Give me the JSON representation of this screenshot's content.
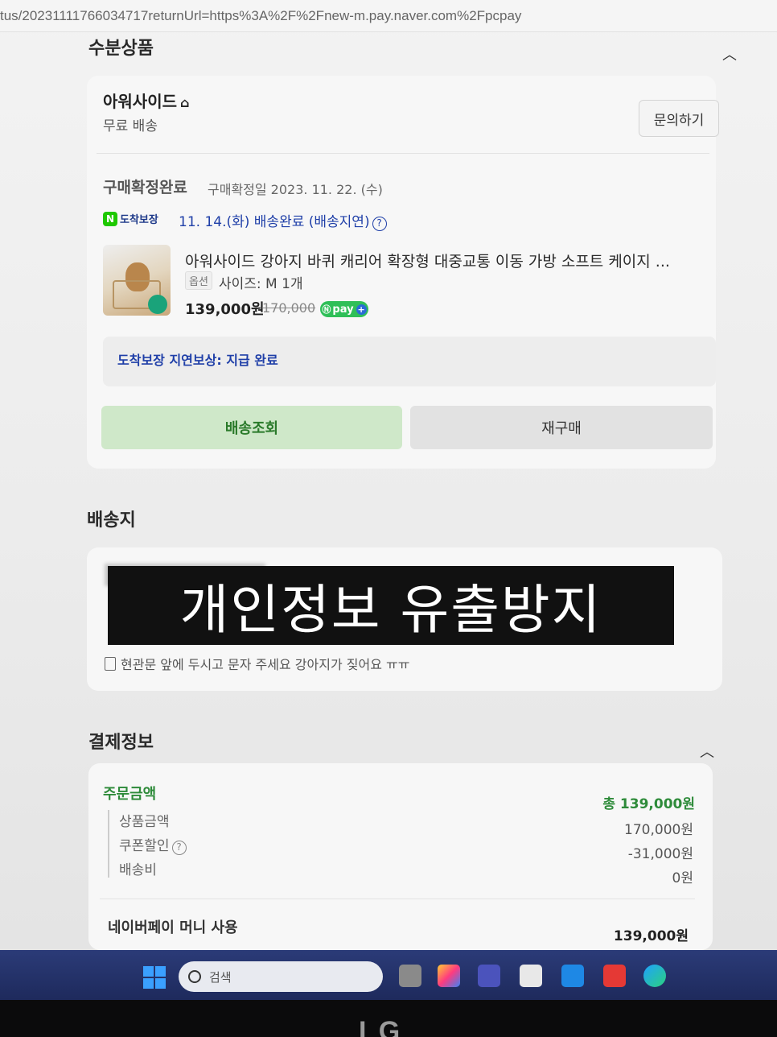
{
  "browser": {
    "url": "tus/20231111766034717returnUrl=https%3A%2F%2Fnew-m.pay.naver.com%2Fpcpay"
  },
  "order_section": {
    "title": "수분상품",
    "collapse_icon": "chevron-up-icon",
    "store": {
      "name": "아워사이드",
      "home_icon": "home-icon",
      "shipping": "무료 배송",
      "inquiry_button": "문의하기"
    },
    "status": {
      "label": "구매확정완료",
      "date": "구매확정일 2023. 11. 22. (수)"
    },
    "delivery": {
      "badge": "도착보장",
      "text": "11. 14.(화) 배송완료 (배송지연)",
      "help_icon": "question-circle-icon"
    },
    "product": {
      "name": "아워사이드 강아지 바퀴 캐리어 확장형 대중교통 이동 가방 소프트 케이지 ...",
      "option_tag": "옵션",
      "option_value": "사이즈: M  1개",
      "price": "139,000원",
      "original_price": "170,000",
      "pay_badge": "pay"
    },
    "compensation": "도착보장 지연보상: 지급 완료",
    "buttons": {
      "track": "배송조회",
      "rebuy": "재구매"
    }
  },
  "shipping_section": {
    "title": "배송지",
    "redaction_overlay": "개인정보 유출방지",
    "memo": "현관문 앞에 두시고 문자 주세요 강아지가 짖어요 ㅠㅠ"
  },
  "payment_section": {
    "title": "결제정보",
    "collapse_icon": "chevron-up-icon",
    "order_amount_label": "주문금액",
    "order_total": "총 139,000원",
    "breakdown": [
      {
        "label": "상품금액",
        "value": "170,000원"
      },
      {
        "label": "쿠폰할인",
        "value": "-31,000원"
      },
      {
        "label": "배송비",
        "value": "0원"
      }
    ],
    "npay_money_label": "네이버페이 머니 사용",
    "npay_money_value": "139,000원"
  },
  "taskbar": {
    "search_placeholder": "검색"
  },
  "monitor_brand": "LG"
}
